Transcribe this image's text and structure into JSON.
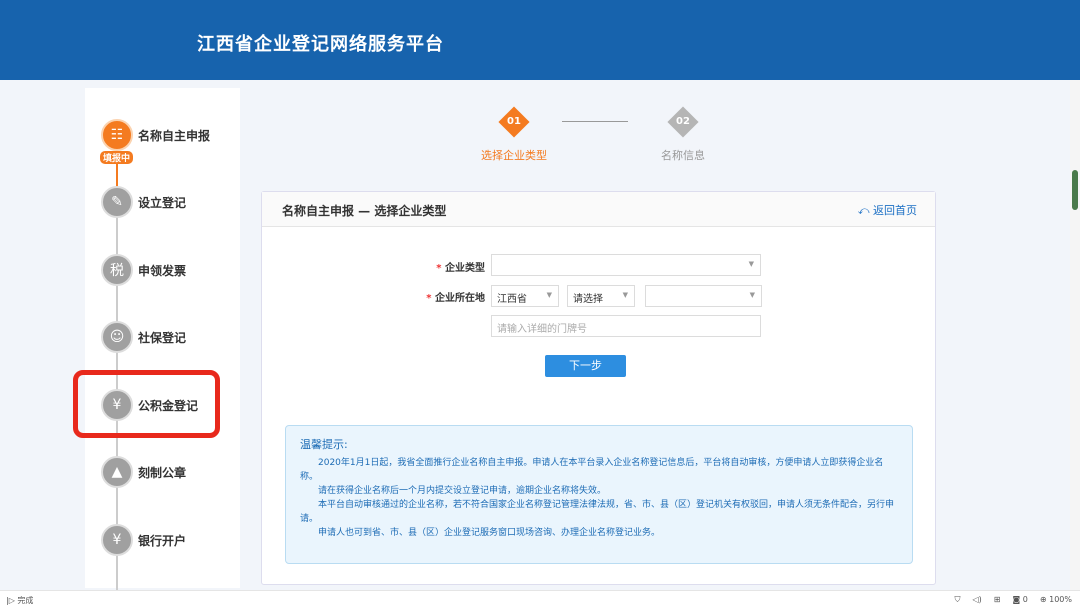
{
  "header": {
    "title": "江西省企业登记网络服务平台"
  },
  "sidebar": {
    "badge": "填报中",
    "items": [
      {
        "label": "名称自主申报",
        "icon": "id-card-icon",
        "glyph": "☷"
      },
      {
        "label": "设立登记",
        "icon": "edit-form-icon",
        "glyph": "✎"
      },
      {
        "label": "申领发票",
        "icon": "tax-invoice-icon",
        "glyph": "税"
      },
      {
        "label": "社保登记",
        "icon": "social-security-icon",
        "glyph": "☺"
      },
      {
        "label": "公积金登记",
        "icon": "housing-fund-icon",
        "glyph": "¥"
      },
      {
        "label": "刻制公章",
        "icon": "seal-icon",
        "glyph": "▲"
      },
      {
        "label": "银行开户",
        "icon": "money-bag-icon",
        "glyph": "¥"
      }
    ]
  },
  "steps": [
    {
      "num": "01",
      "label": "选择企业类型",
      "color": "#f47b20"
    },
    {
      "num": "02",
      "label": "名称信息",
      "color": "#b5b5b5"
    }
  ],
  "card": {
    "title": "名称自主申报 — 选择企业类型",
    "back": "返回首页",
    "form": {
      "type_label": "企业类型",
      "location_label": "企业所在地",
      "required": "*",
      "province": "江西省",
      "city": "请选择",
      "district": "",
      "address_placeholder": "请输入详细的门牌号",
      "next": "下一步"
    },
    "tips": {
      "title": "温馨提示:",
      "paragraphs": [
        "2020年1月1日起，我省全面推行企业名称自主申报。申请人在本平台录入企业名称登记信息后，平台将自动审核，方便申请人立即获得企业名称。",
        "请在获得企业名称后一个月内提交设立登记申请，逾期企业名称将失效。",
        "本平台自动审核通过的企业名称，若不符合国家企业名称登记管理法律法规，省、市、县（区）登记机关有权驳回，申请人须无条件配合，另行申请。",
        "申请人也可到省、市、县（区）企业登记服务窗口现场咨询、办理企业名称登记业务。"
      ]
    }
  },
  "statusbar": {
    "left": "完成",
    "count": "0",
    "zoom": "100%"
  }
}
